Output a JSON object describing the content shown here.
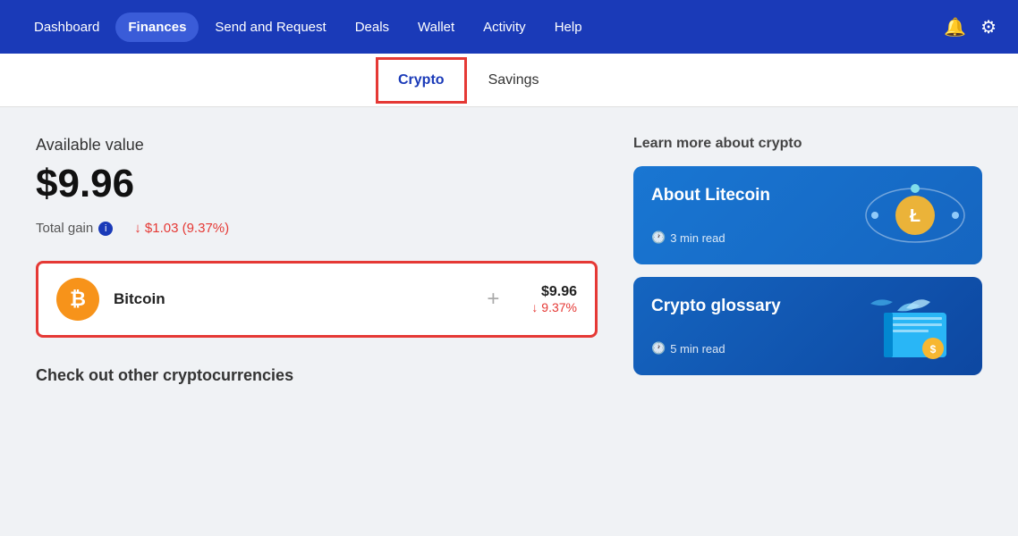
{
  "nav": {
    "items": [
      {
        "label": "Dashboard",
        "active": false
      },
      {
        "label": "Finances",
        "active": true
      },
      {
        "label": "Send and Request",
        "active": false
      },
      {
        "label": "Deals",
        "active": false
      },
      {
        "label": "Wallet",
        "active": false
      },
      {
        "label": "Activity",
        "active": false
      },
      {
        "label": "Help",
        "active": false
      }
    ]
  },
  "subTabs": [
    {
      "label": "Crypto",
      "active": true
    },
    {
      "label": "Savings",
      "active": false
    }
  ],
  "main": {
    "availableLabel": "Available value",
    "availableValue": "$9.96",
    "totalGainLabel": "Total gain",
    "totalGainValue": "↓ $1.03 (9.37%)",
    "cryptoCard": {
      "name": "Bitcoin",
      "usd": "$9.96",
      "pct": "↓ 9.37%",
      "plusLabel": "+"
    },
    "checkOutLabel": "Check out other cryptocurrencies"
  },
  "right": {
    "learnLabel": "Learn more about crypto",
    "cards": [
      {
        "title": "About Litecoin",
        "meta": "3 min read"
      },
      {
        "title": "Crypto glossary",
        "meta": "5 min read"
      }
    ]
  },
  "icons": {
    "bell": "🔔",
    "gear": "⚙",
    "info": "i",
    "clock": "🕐"
  }
}
